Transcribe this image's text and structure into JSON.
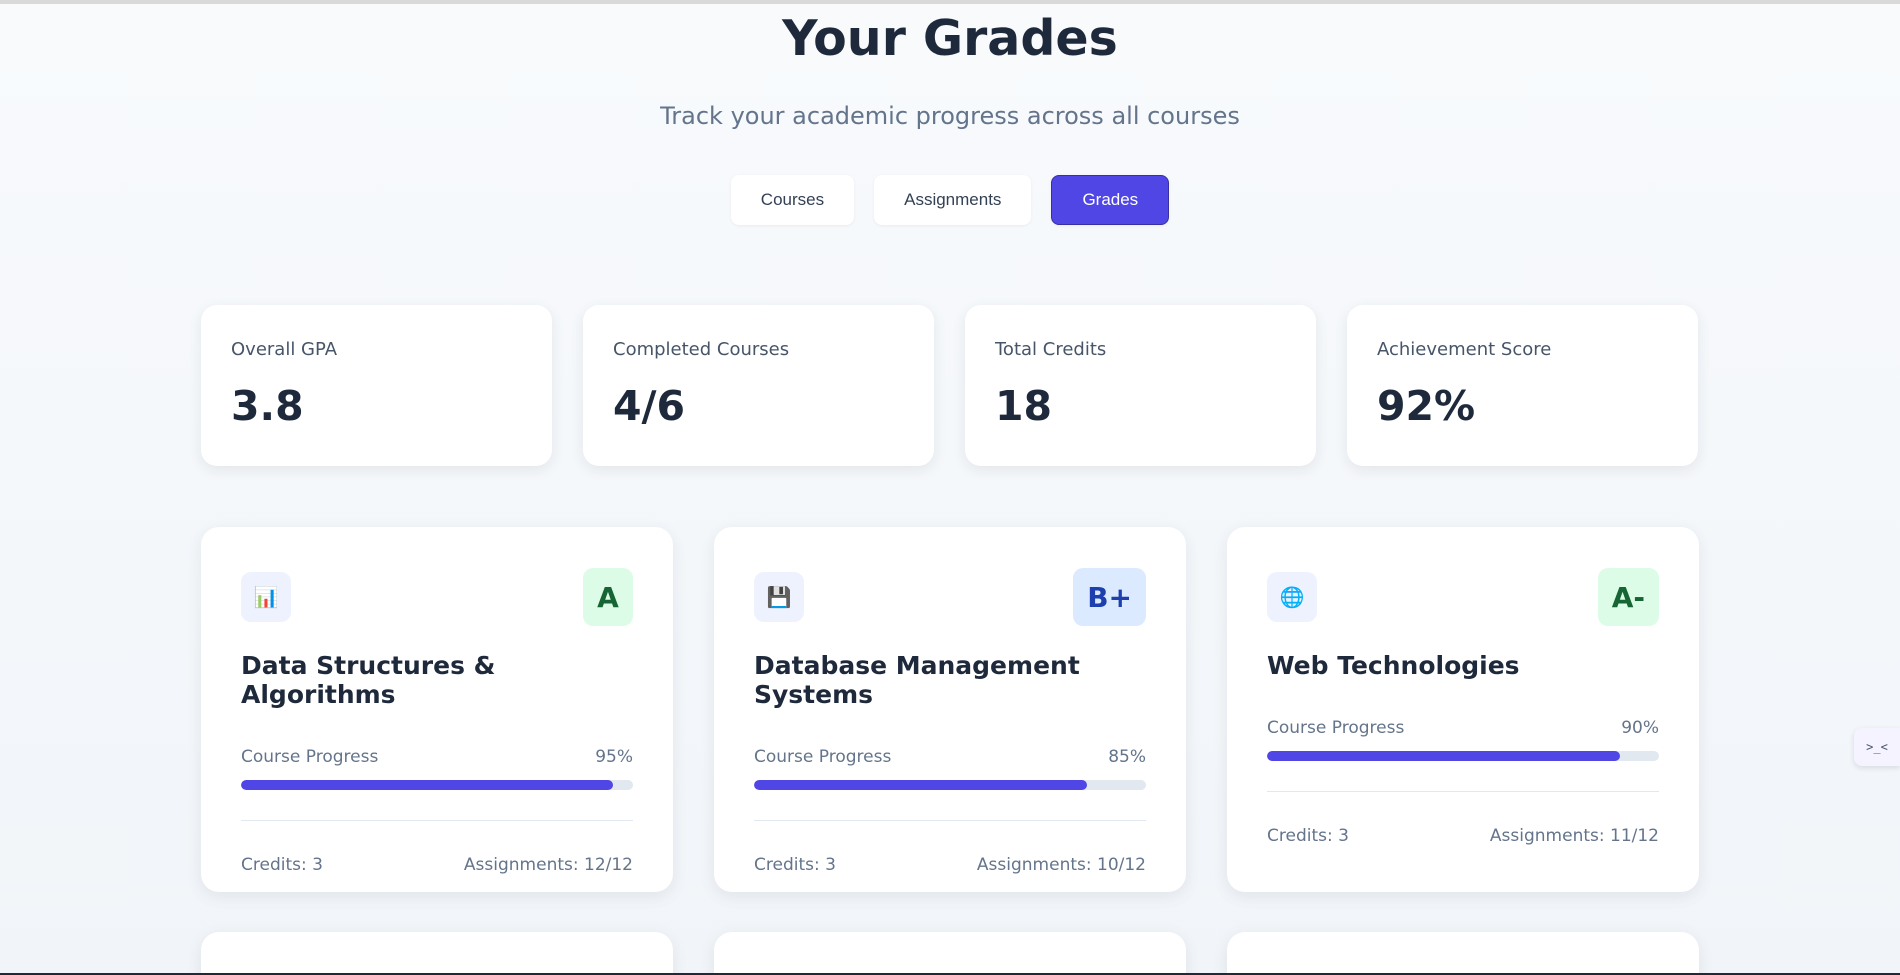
{
  "header": {
    "title": "Your Grades",
    "subtitle": "Track your academic progress across all courses"
  },
  "tabs": [
    {
      "label": "Courses",
      "active": false
    },
    {
      "label": "Assignments",
      "active": false
    },
    {
      "label": "Grades",
      "active": true
    }
  ],
  "stats": [
    {
      "label": "Overall GPA",
      "value": "3.8"
    },
    {
      "label": "Completed Courses",
      "value": "4/6"
    },
    {
      "label": "Total Credits",
      "value": "18"
    },
    {
      "label": "Achievement Score",
      "value": "92%"
    }
  ],
  "courses": [
    {
      "icon": "bar-chart-icon",
      "icon_glyph": "📊",
      "grade": "A",
      "grade_bg": "#dcfce7",
      "grade_color": "#166534",
      "title": "Data Structures & Algorithms",
      "progress_label": "Course Progress",
      "progress_text": "95%",
      "progress": 0.95,
      "credits": "Credits: 3",
      "assignments": "Assignments: 12/12"
    },
    {
      "icon": "floppy-disk-icon",
      "icon_glyph": "💾",
      "grade": "B+",
      "grade_bg": "#dbeafe",
      "grade_color": "#1e40af",
      "title": "Database Management Systems",
      "progress_label": "Course Progress",
      "progress_text": "85%",
      "progress": 0.85,
      "credits": "Credits: 3",
      "assignments": "Assignments: 10/12"
    },
    {
      "icon": "globe-icon",
      "icon_glyph": "🌐",
      "grade": "A-",
      "grade_bg": "#dcfce7",
      "grade_color": "#166534",
      "title": "Web Technologies",
      "progress_label": "Course Progress",
      "progress_text": "90%",
      "progress": 0.9,
      "credits": "Credits: 3",
      "assignments": "Assignments: 11/12"
    }
  ],
  "side_widget": {
    "label": ">_<",
    "icon": "extension-widget-icon"
  },
  "colors": {
    "accent": "#4f46e5",
    "text": "#1e293b",
    "muted": "#64748b"
  }
}
